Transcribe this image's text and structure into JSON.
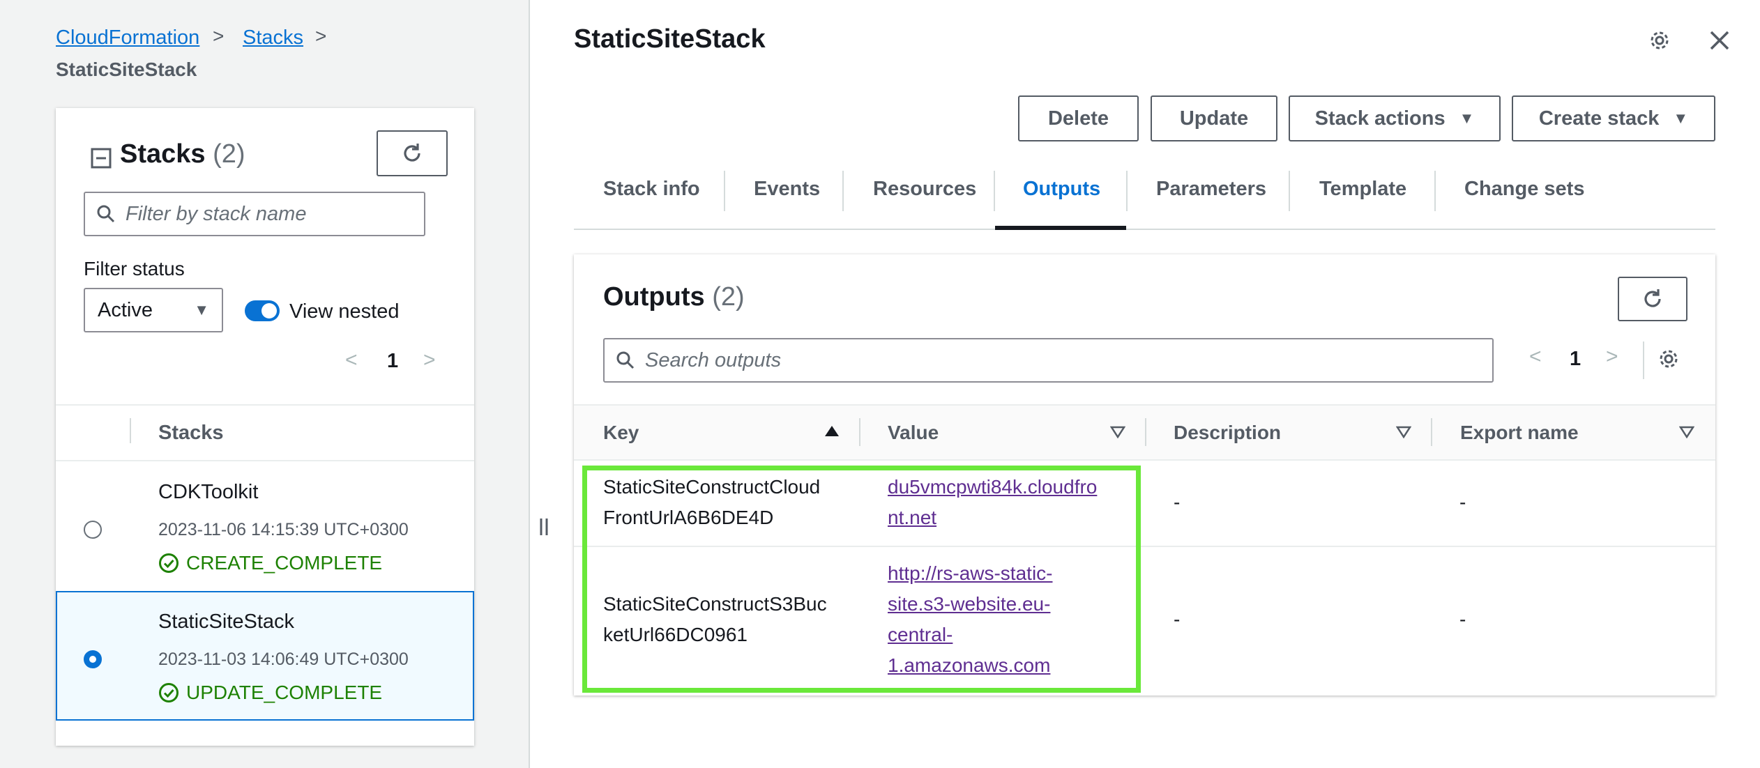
{
  "breadcrumb": {
    "items": [
      "CloudFormation",
      "Stacks"
    ],
    "current": "StaticSiteStack"
  },
  "stacks_panel": {
    "title": "Stacks",
    "count": "(2)",
    "filter_placeholder": "Filter by stack name",
    "filter_status_label": "Filter status",
    "filter_status_value": "Active",
    "view_nested_label": "View nested",
    "page": "1",
    "column_header": "Stacks",
    "stacks": [
      {
        "name": "CDKToolkit",
        "date": "2023-11-06 14:15:39 UTC+0300",
        "status": "CREATE_COMPLETE",
        "selected": false
      },
      {
        "name": "StaticSiteStack",
        "date": "2023-11-03 14:06:49 UTC+0300",
        "status": "UPDATE_COMPLETE",
        "selected": true
      }
    ]
  },
  "detail": {
    "title": "StaticSiteStack",
    "buttons": {
      "delete": "Delete",
      "update": "Update",
      "stack_actions": "Stack actions",
      "create_stack": "Create stack"
    },
    "tabs": [
      "Stack info",
      "Events",
      "Resources",
      "Outputs",
      "Parameters",
      "Template",
      "Change sets"
    ],
    "active_tab": "Outputs"
  },
  "outputs": {
    "title": "Outputs",
    "count": "(2)",
    "search_placeholder": "Search outputs",
    "page": "1",
    "columns": [
      "Key",
      "Value",
      "Description",
      "Export name"
    ],
    "rows": [
      {
        "key_line1": "StaticSiteConstructCloud",
        "key_line2": "FrontUrlA6B6DE4D",
        "value_lines": [
          "du5vmcpwti84k.cloudfro",
          "nt.net"
        ],
        "description": "-",
        "export_name": "-"
      },
      {
        "key_line1": "StaticSiteConstructS3Buc",
        "key_line2": "ketUrl66DC0961",
        "value_lines": [
          "http://rs-aws-static-",
          "site.s3-website.eu-",
          "central-",
          "1.amazonaws.com"
        ],
        "description": "-",
        "export_name": "-"
      }
    ]
  },
  "colors": {
    "accent": "#0972d3",
    "success": "#1d8102",
    "highlight": "#6ae83a",
    "visited_link": "#5f2e91"
  }
}
